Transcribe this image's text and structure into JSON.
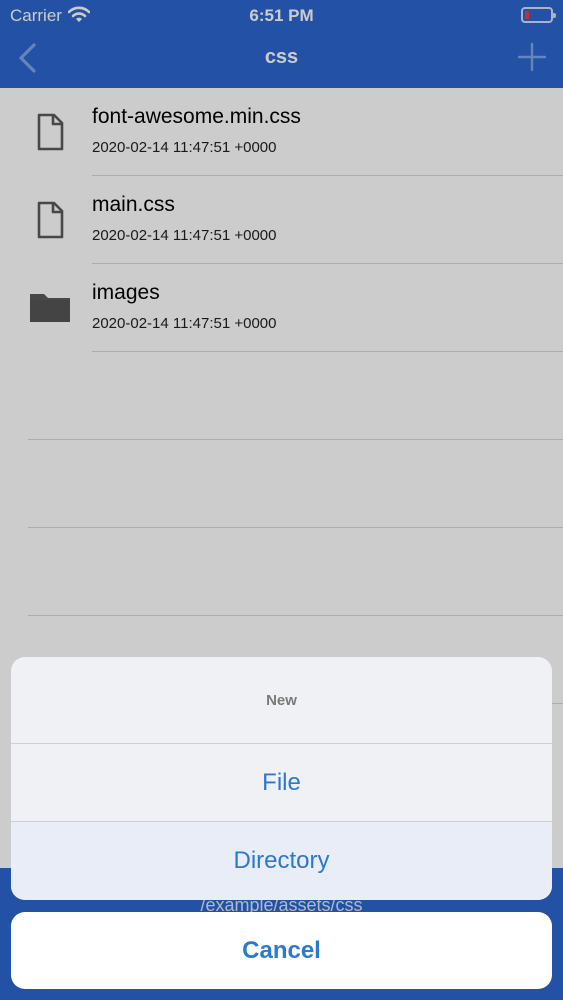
{
  "status_bar": {
    "carrier": "Carrier",
    "time": "6:51 PM"
  },
  "nav": {
    "title": "css",
    "back_icon": "chevron-left-icon",
    "add_icon": "plus-icon"
  },
  "files": [
    {
      "name": "font-awesome.min.css",
      "date": "2020-02-14 11:47:51 +0000",
      "type": "file"
    },
    {
      "name": "main.css",
      "date": "2020-02-14 11:47:51 +0000",
      "type": "file"
    },
    {
      "name": "images",
      "date": "2020-02-14 11:47:51 +0000",
      "type": "folder"
    }
  ],
  "path": "/example/assets/css",
  "action_sheet": {
    "title": "New",
    "options": [
      "File",
      "Directory"
    ],
    "cancel": "Cancel"
  },
  "colors": {
    "accent": "#2b66cf",
    "action_text": "#2a79d3",
    "battery_low": "#ff3b30"
  }
}
